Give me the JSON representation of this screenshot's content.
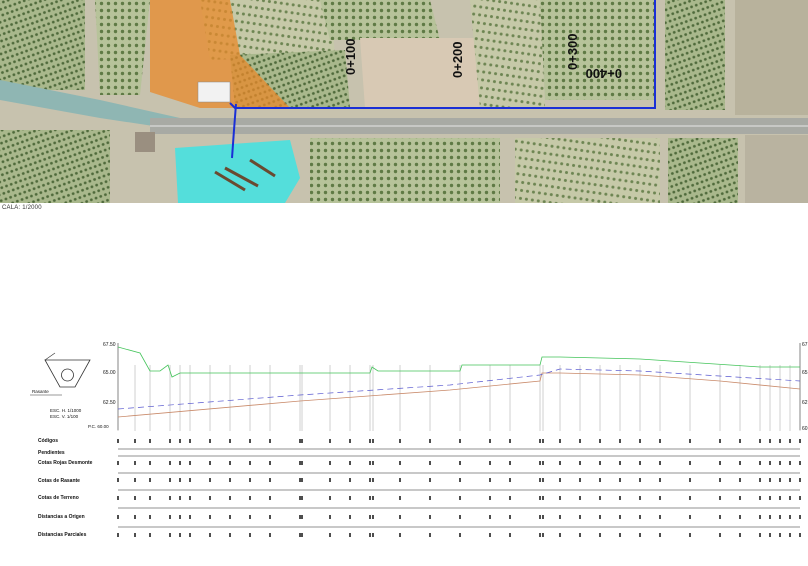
{
  "map": {
    "pk_labels": [
      "0+100",
      "0+200",
      "0+300",
      "0+400"
    ],
    "scale_label": "CALA: 1/2000",
    "colors": {
      "pipeline": "#1a2fd6",
      "orange_zone": "#e8892b",
      "cyan_zone": "#3fe3e3"
    }
  },
  "profile": {
    "legend_label": "Rasante",
    "pc_label": "P.C. 60.00",
    "scale_lines": [
      "ESC. H. 1/1000",
      "ESC. V. 1/100"
    ],
    "axis_ticks_left": [
      "67.50",
      "65.00",
      "62.50"
    ],
    "axis_ticks_right": [
      "67",
      "65",
      "62",
      "60"
    ],
    "rows": [
      "Códigos",
      "Pendientes",
      "Cotas Rojas Desmonte",
      "Cotas de Rasante",
      "Cotas de Terreno",
      "Distancias a Origen",
      "Distancias Parciales"
    ],
    "colors": {
      "terrain": "#43c45a",
      "grade": "#c98a6a",
      "pipe": "#5a5ad0"
    }
  }
}
